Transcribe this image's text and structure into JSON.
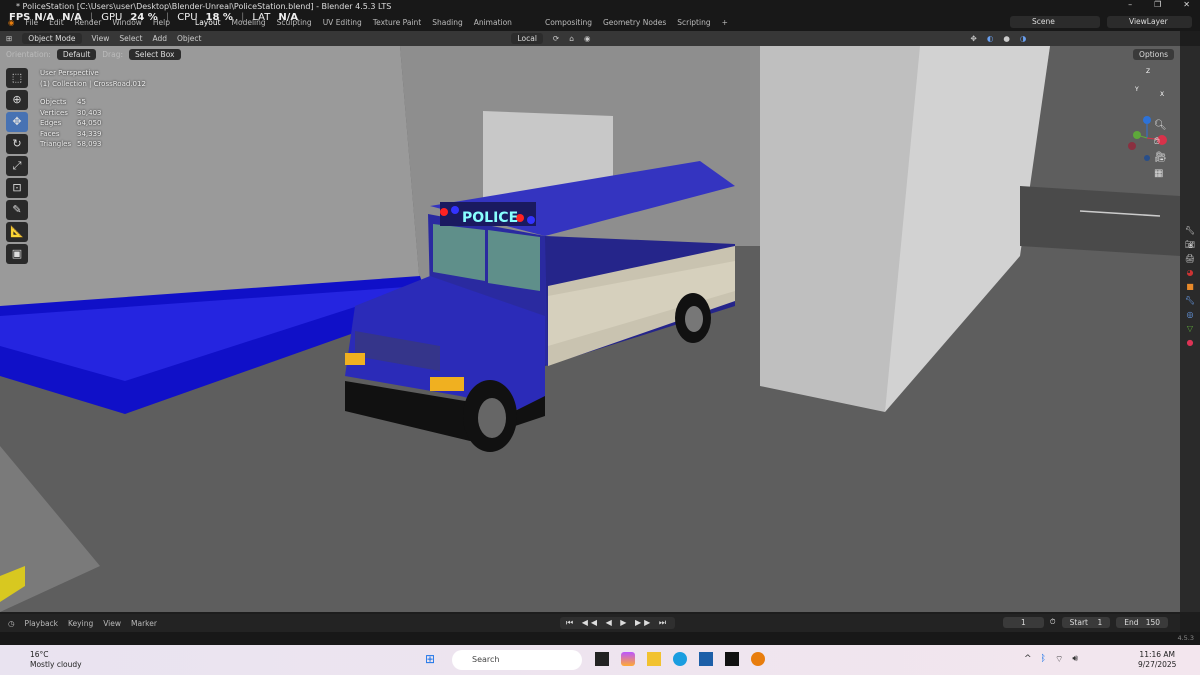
{
  "window": {
    "title": "* PoliceStation [C:\\Users\\user\\Desktop\\Blender-Unreal\\PoliceStation.blend] - Blender 4.5.3 LTS",
    "controls": [
      "–",
      "❐",
      "✕"
    ]
  },
  "hud": {
    "fps": "FPS",
    "fps_val": "N/A",
    "fps_val2": "N/A",
    "gpu": "GPU",
    "gpu_val": "24 %",
    "cpu": "CPU",
    "cpu_val": "18 %",
    "lat": "LAT",
    "lat_val": "N/A"
  },
  "menu": [
    "File",
    "Edit",
    "Render",
    "Window",
    "Help"
  ],
  "workspaces": [
    "Layout",
    "Modeling",
    "Sculpting",
    "UV Editing",
    "Texture Paint",
    "Shading",
    "Animation",
    "Compositing",
    "Geometry Nodes",
    "Scripting",
    "+"
  ],
  "scene": "Scene",
  "view_layer": "ViewLayer",
  "header": {
    "mode": "Object Mode",
    "menus": [
      "View",
      "Select",
      "Add",
      "Object"
    ],
    "transform": "Local"
  },
  "toolsettings": {
    "orientation_label": "Orientation:",
    "orientation": "Default",
    "drag_label": "Drag:",
    "drag": "Select Box",
    "options": "Options"
  },
  "overlay": {
    "view": "User Perspective",
    "collection": "(1) Collection | CrossRoad.012"
  },
  "stats": [
    [
      "Objects",
      "45"
    ],
    [
      "Vertices",
      "30,403"
    ],
    [
      "Edges",
      "64,050"
    ],
    [
      "Faces",
      "34,339"
    ],
    [
      "Triangles",
      "58,093"
    ]
  ],
  "scene_text": {
    "sign": "POLICE"
  },
  "gizmo": {
    "x": "X",
    "y": "Y",
    "z": "Z"
  },
  "timeline": {
    "menus": [
      "Playback",
      "Keying",
      "View",
      "Marker"
    ],
    "controls": "⏮ ◀◀ ◀ ▶ ▶▶ ⏭",
    "current": "1",
    "start_label": "Start",
    "start": "1",
    "end_label": "End",
    "end": "150"
  },
  "status": {
    "version": "4.5.3"
  },
  "taskbar": {
    "temp": "16°C",
    "weather": "Mostly cloudy",
    "search": "Search",
    "time": "11:16 AM",
    "date": "9/27/2025"
  }
}
